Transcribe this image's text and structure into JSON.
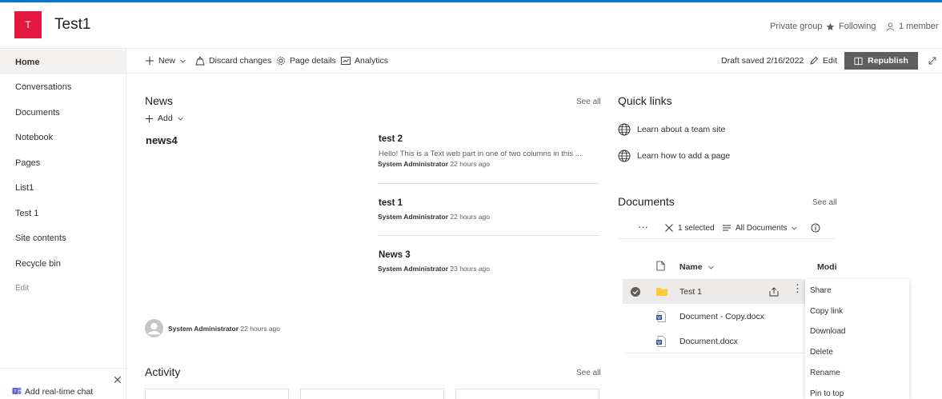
{
  "site": {
    "logo_letter": "T",
    "title": "Test1",
    "privacy": "Private group",
    "following": "Following",
    "members": "1 member",
    "logo_color": "#e3173f",
    "accent": "#0078d4"
  },
  "nav": {
    "items": [
      {
        "label": "Home"
      },
      {
        "label": "Conversations"
      },
      {
        "label": "Documents"
      },
      {
        "label": "Notebook"
      },
      {
        "label": "Pages"
      },
      {
        "label": "List1"
      },
      {
        "label": "Test 1"
      },
      {
        "label": "Site contents"
      },
      {
        "label": "Recycle bin"
      },
      {
        "label": "Edit"
      }
    ],
    "chat_label": "Add real-time chat"
  },
  "commands": {
    "new": "New",
    "discard": "Discard changes",
    "page_details": "Page details",
    "analytics": "Analytics",
    "draft_status": "Draft saved 2/16/2022",
    "edit": "Edit",
    "republish": "Republish"
  },
  "news": {
    "title": "News",
    "see_all": "See all",
    "add": "Add",
    "hero_title": "news4",
    "hero_author": "System Administrator",
    "hero_time": "22 hours ago",
    "items": [
      {
        "title": "test 2",
        "desc": "Hello! This is a Text web part in one of two columns in this ...",
        "author": "System Administrator",
        "time": "22 hours ago"
      },
      {
        "title": "test 1",
        "author": "System Administrator",
        "time": "22 hours ago"
      },
      {
        "title": "News 3",
        "author": "System Administrator",
        "time": "23 hours ago"
      }
    ]
  },
  "activity": {
    "title": "Activity",
    "see_all": "See all"
  },
  "quick_links": {
    "title": "Quick links",
    "items": [
      {
        "label": "Learn about a team site"
      },
      {
        "label": "Learn how to add a page"
      }
    ]
  },
  "documents": {
    "title": "Documents",
    "see_all": "See all",
    "selected": "1 selected",
    "view": "All Documents",
    "col_name": "Name",
    "col_modified": "Modi",
    "rows": [
      {
        "name": "Test 1",
        "type": "folder",
        "selected": true
      },
      {
        "name": "Document - Copy.docx",
        "type": "word"
      },
      {
        "name": "Document.docx",
        "type": "word"
      }
    ]
  },
  "context_menu": {
    "items": [
      "Share",
      "Copy link",
      "Download",
      "Delete",
      "Rename",
      "Pin to top"
    ]
  }
}
